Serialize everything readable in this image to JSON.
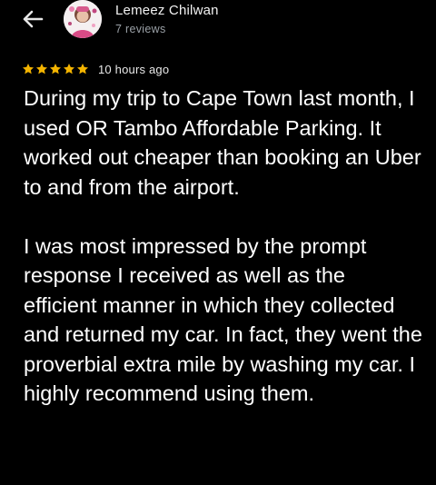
{
  "header": {
    "back_icon": "arrow-left-icon",
    "reviewer_name": "Lemeez Chilwan",
    "review_count": "7 reviews",
    "avatar_icon": "profile-photo"
  },
  "review": {
    "rating": 5,
    "rating_max": 5,
    "star_color": "#f4b400",
    "time_ago": "10 hours ago",
    "paragraphs": [
      "During my trip to Cape Town last month, I used OR Tambo Affordable Parking. It worked out cheaper than booking an Uber to and from the airport.",
      "I was most impressed by the prompt response I received as well as the efficient manner in which they collected and returned my car. In fact, they went the proverbial extra mile by washing my car. I highly recommend using them."
    ]
  }
}
